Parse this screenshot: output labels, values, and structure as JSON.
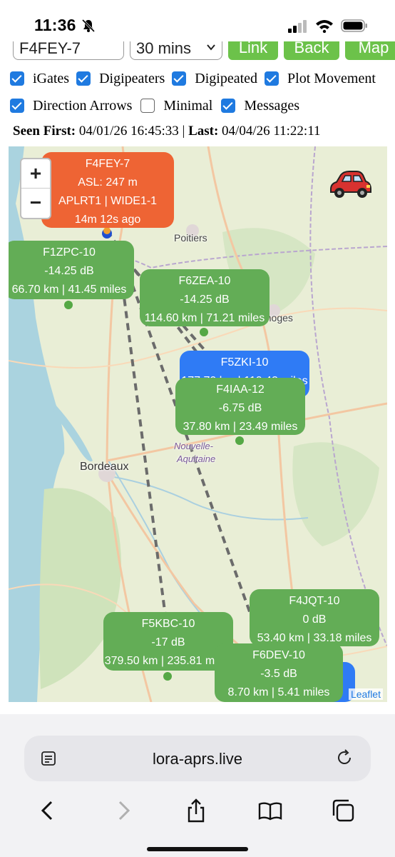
{
  "status_bar": {
    "time": "11:36"
  },
  "form": {
    "callsign_value": "F4FEY-7",
    "interval_value": "30 mins",
    "buttons": [
      "Link",
      "Back",
      "Map"
    ]
  },
  "options_row1": [
    {
      "label": "iGates",
      "checked": true
    },
    {
      "label": "Digipeaters",
      "checked": true
    },
    {
      "label": "Digipeated",
      "checked": true
    },
    {
      "label": "Plot Movement",
      "checked": true
    }
  ],
  "options_row2": [
    {
      "label": "Direction Arrows",
      "checked": true
    },
    {
      "label": "Minimal",
      "checked": false
    },
    {
      "label": "Messages",
      "checked": true
    }
  ],
  "seen": {
    "first_label": "Seen First:",
    "first_value": "04/01/26 16:45:33",
    "sep": "|",
    "last_label": "Last:",
    "last_value": "04/04/26 11:22:11"
  },
  "map": {
    "zoom_in": "+",
    "zoom_out": "−",
    "attribution": "Leaflet",
    "places": {
      "poitiers": "Poitiers",
      "limoges": "Limoges",
      "bordeaux": "Bordeaux",
      "region_1": "Nouvelle-",
      "region_2": "Aquitaine"
    },
    "station_popup": {
      "call": "F4FEY-7",
      "asl": "ASL: 247 m",
      "path": "APLRT1 | WIDE1-1",
      "ago": "14m 12s ago"
    },
    "popups": {
      "f1zpc": {
        "call": "F1ZPC-10",
        "snr": "-14.25 dB",
        "dist": "66.70 km | 41.45 miles"
      },
      "f6zea": {
        "call": "F6ZEA-10",
        "snr": "-14.25 dB",
        "dist": "114.60 km | 71.21 miles"
      },
      "f5zki": {
        "call": "F5ZKI-10",
        "dist": "177.70 km | 110.42 miles"
      },
      "f4iaa": {
        "call": "F4IAA-12",
        "snr": "-6.75 dB",
        "dist": "37.80 km | 23.49 miles"
      },
      "f4jqt": {
        "call": "F4JQT-10",
        "snr": "0 dB",
        "dist": "53.40 km | 33.18 miles"
      },
      "f5kbc": {
        "call": "F5KBC-10",
        "snr": "-17 dB",
        "dist": "379.50 km | 235.81 miles"
      },
      "f6dev": {
        "call": "F6DEV-10",
        "snr": "-3.5 dB",
        "dist": "8.70 km | 5.41 miles"
      }
    }
  },
  "browser": {
    "url": "lora-aprs.live"
  },
  "colors": {
    "accent": "#1f7ae0",
    "green": "#63ad56",
    "orange": "#ee6434",
    "blue": "#2f7bf5"
  },
  "icons": [
    "bell-slash-icon",
    "signal-icon",
    "wifi-icon",
    "battery-icon",
    "car-icon",
    "reader-icon",
    "reload-icon",
    "back-icon",
    "forward-icon",
    "share-icon",
    "bookmarks-icon",
    "tabs-icon"
  ]
}
